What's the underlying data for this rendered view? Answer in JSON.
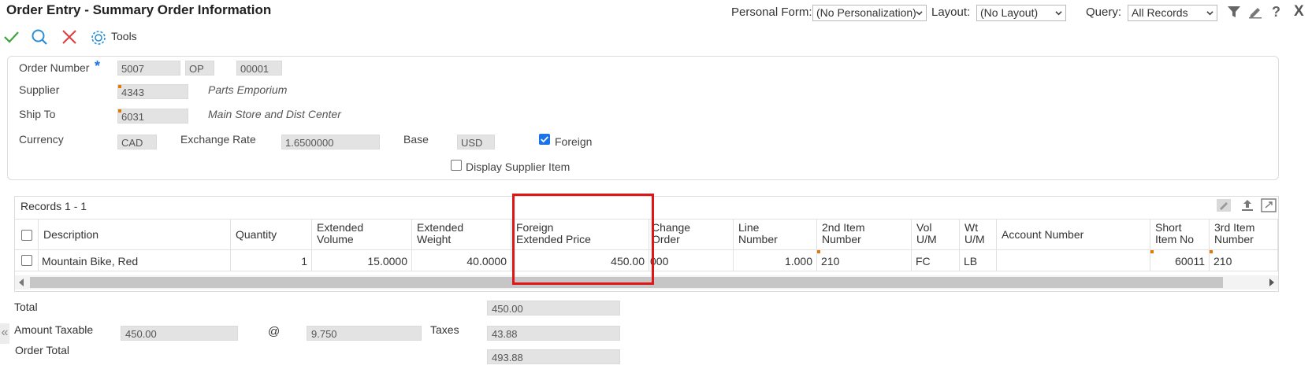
{
  "window": {
    "title": "Order Entry - Summary Order Information"
  },
  "header_controls": {
    "personal_form_label": "Personal Form:",
    "personal_form_value": "(No Personalization)",
    "layout_label": "Layout:",
    "layout_value": "(No Layout)",
    "query_label": "Query:",
    "query_value": "All Records"
  },
  "toolbar": {
    "tools_label": "Tools"
  },
  "order": {
    "order_number_label": "Order Number",
    "order_number_required": "*",
    "order_number": "5007",
    "order_type": "OP",
    "order_company": "00001",
    "supplier_label": "Supplier",
    "supplier_number": "4343",
    "supplier_name": "Parts Emporium",
    "ship_to_label": "Ship To",
    "ship_to_number": "6031",
    "ship_to_name": "Main Store and Dist Center",
    "currency_label": "Currency",
    "currency_value": "CAD",
    "exchange_rate_label": "Exchange Rate",
    "exchange_rate_value": "1.6500000",
    "base_label": "Base",
    "base_value": "USD",
    "foreign_label": "Foreign",
    "foreign_checked": true,
    "display_supplier_item_label": "Display Supplier Item",
    "display_supplier_item_checked": false
  },
  "grid": {
    "records_label": "Records 1 - 1",
    "columns": [
      [
        "Description"
      ],
      [
        "Quantity"
      ],
      [
        "Extended",
        "Volume"
      ],
      [
        "Extended",
        "Weight"
      ],
      [
        "Foreign",
        "Extended Price"
      ],
      [
        "Change",
        "Order"
      ],
      [
        "Line",
        "Number"
      ],
      [
        "2nd Item",
        "Number"
      ],
      [
        "Vol",
        "U/M"
      ],
      [
        "Wt",
        "U/M"
      ],
      [
        "Account Number"
      ],
      [
        "Short",
        "Item No"
      ],
      [
        "3rd Item",
        "Number"
      ]
    ],
    "rows": [
      {
        "description": "Mountain Bike, Red",
        "quantity": "1",
        "extended_volume": "15.0000",
        "extended_weight": "40.0000",
        "foreign_extended_price": "450.00",
        "change_order": "000",
        "line_number": "1.000",
        "second_item_number": "210",
        "vol_um": "FC",
        "wt_um": "LB",
        "account_number": "",
        "short_item_no": "60011",
        "third_item_number": "210"
      }
    ]
  },
  "totals": {
    "total_label": "Total",
    "total_value": "450.00",
    "amount_taxable_label": "Amount Taxable",
    "amount_taxable_value": "450.00",
    "at_symbol": "@",
    "tax_rate_value": "9.750",
    "taxes_label": "Taxes",
    "taxes_value": "43.88",
    "order_total_label": "Order Total",
    "order_total_value": "493.88"
  },
  "colors": {
    "accent_blue": "#1a73e8",
    "highlight_red": "#e01616",
    "required_marker": "#e57a00",
    "ok_green": "#3fa33f",
    "cancel_red": "#e23c3c"
  },
  "icons": {
    "ok": "check-icon",
    "find": "search-icon",
    "cancel": "close-icon",
    "tools": "gear-icon",
    "filter": "filter-icon",
    "personalize": "pencil-icon",
    "help": "help-icon",
    "close": "close-x-icon"
  }
}
